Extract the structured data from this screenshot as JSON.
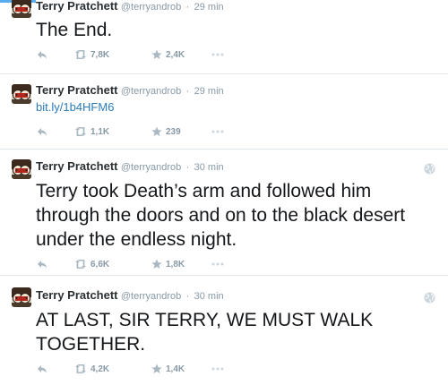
{
  "tweets": [
    {
      "name": "Terry Pratchett",
      "handle": "@terryandrob",
      "dot": "·",
      "time": "29 min",
      "text_lines": [
        "The End."
      ],
      "retweets": "7,8K",
      "favorites": "2,4K"
    },
    {
      "name": "Terry Pratchett",
      "handle": "@terryandrob",
      "dot": "·",
      "time": "29 min",
      "link": "bit.ly/1b4HFM6",
      "retweets": "1,1K",
      "favorites": "239"
    },
    {
      "name": "Terry Pratchett",
      "handle": "@terryandrob",
      "dot": "·",
      "time": "30 min",
      "text_lines": [
        "Terry took Death’s arm and followed him",
        "through the doors and on to the black desert",
        "under the endless night."
      ],
      "retweets": "6,6K",
      "favorites": "1,8K"
    },
    {
      "name": "Terry Pratchett",
      "handle": "@terryandrob",
      "dot": "·",
      "time": "30 min",
      "text_lines": [
        "AT LAST, SIR TERRY, WE MUST WALK",
        "TOGETHER."
      ],
      "retweets": "4,2K",
      "favorites": "1,4K"
    }
  ],
  "icons": {
    "reply": "reply-icon",
    "retweet": "retweet-icon",
    "favorite": "star-icon",
    "more": "more-dots-icon",
    "globe": "globe-icon"
  },
  "colors": {
    "accent": "#55acee",
    "link": "#2b7bb9",
    "meta": "#8899a6",
    "divider": "#e1e8ed"
  }
}
